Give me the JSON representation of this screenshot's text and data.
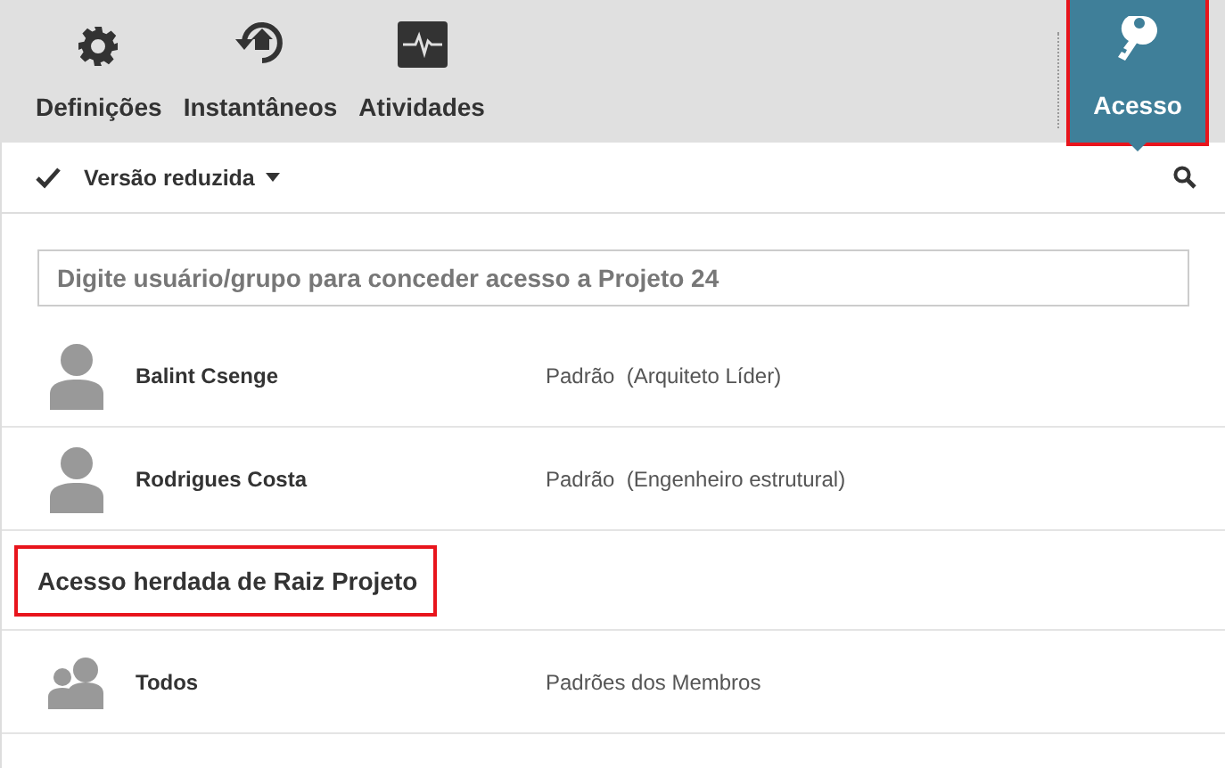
{
  "toolbar": {
    "tabs": [
      {
        "label": "Definições",
        "kind": "gear",
        "selected": false,
        "highlighted": false
      },
      {
        "label": "Instantâneos",
        "kind": "history",
        "selected": false,
        "highlighted": false
      },
      {
        "label": "Atividades",
        "kind": "activity",
        "selected": false,
        "highlighted": false
      },
      {
        "label": "Acesso",
        "kind": "key",
        "selected": true,
        "highlighted": true
      }
    ]
  },
  "options_bar": {
    "view": {
      "label": "Versão reduzida",
      "checked": true
    }
  },
  "grant_field": {
    "placeholder": "Digite usuário/grupo para conceder acesso a Projeto 24"
  },
  "members": [
    {
      "name": "Balint Csenge",
      "kind": "user",
      "role": "Padrão",
      "detail": "(Arquiteto Líder)"
    },
    {
      "name": "Rodrigues Costa",
      "kind": "user",
      "role": "Padrão",
      "detail": "(Engenheiro estrutural)"
    }
  ],
  "inherited": {
    "title": "Acesso herdada de Raiz Projeto",
    "highlighted": true,
    "members": [
      {
        "name": "Todos",
        "kind": "group",
        "role": "Padrões dos Membros"
      }
    ]
  }
}
